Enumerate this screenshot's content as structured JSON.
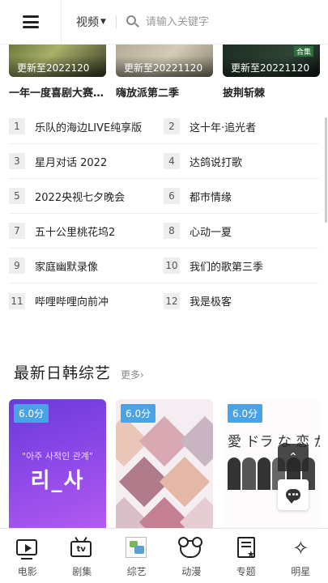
{
  "header": {
    "category": "视频",
    "search_placeholder": "请输入关键字"
  },
  "top_posters": [
    {
      "caption": "更新至2022120",
      "title": "一年一度喜剧大赛第二季"
    },
    {
      "caption": "更新至20221120",
      "title": "嗨放派第二季"
    },
    {
      "caption": "更新至20221120",
      "title": "披荆斩棘",
      "tag": "合集"
    }
  ],
  "ranking": [
    {
      "num": "1",
      "name": "乐队的海边LIVE纯享版"
    },
    {
      "num": "2",
      "name": "这十年·追光者"
    },
    {
      "num": "3",
      "name": "星月对话 2022"
    },
    {
      "num": "4",
      "name": "达鸽说打歌"
    },
    {
      "num": "5",
      "name": "2022央视七夕晚会"
    },
    {
      "num": "6",
      "name": "都市情缘"
    },
    {
      "num": "7",
      "name": "五十公里桃花坞2"
    },
    {
      "num": "8",
      "name": "心动一夏"
    },
    {
      "num": "9",
      "name": "家庭幽默录像"
    },
    {
      "num": "10",
      "name": "我们的歌第三季"
    },
    {
      "num": "11",
      "name": "哔哩哔哩向前冲"
    },
    {
      "num": "12",
      "name": "我是极客"
    }
  ],
  "section": {
    "title": "最新日韩综艺",
    "more": "更多›"
  },
  "cards": [
    {
      "score": "6.0分",
      "line1": "\"아주 사적인 관계\"",
      "line2": "리_사"
    },
    {
      "score": "6.0分"
    },
    {
      "score": "6.0分",
      "line1": "愛 ドラ な 恋 がした"
    }
  ],
  "floating": {
    "up_icon": "⌃"
  },
  "bottom_nav": [
    {
      "label": "电影",
      "icon": "movie-icon"
    },
    {
      "label": "剧集",
      "icon": "tv-icon"
    },
    {
      "label": "综艺",
      "icon": "variety-icon"
    },
    {
      "label": "动漫",
      "icon": "anime-icon"
    },
    {
      "label": "专题",
      "icon": "topic-icon"
    },
    {
      "label": "明星",
      "icon": "star-icon"
    }
  ],
  "colors": {
    "score_badge": "#4aa3e6",
    "rank_badge_bg": "#eeeeee"
  }
}
